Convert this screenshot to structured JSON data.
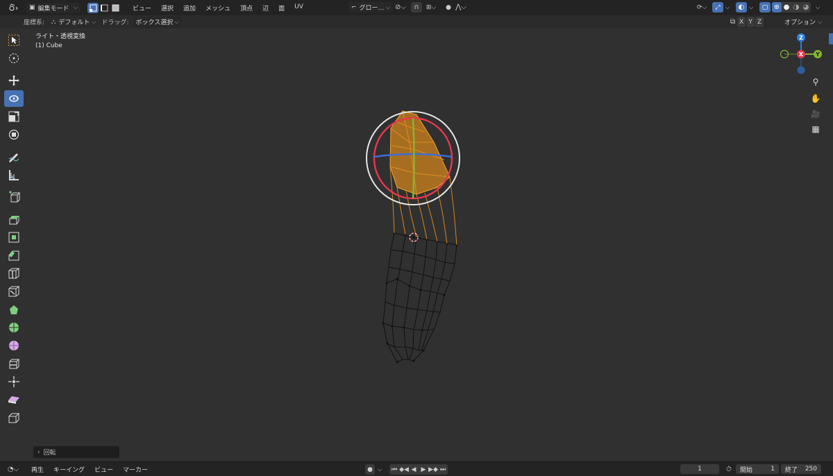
{
  "header": {
    "mode_label": "編集モード",
    "menus": [
      "ビュー",
      "選択",
      "追加",
      "メッシュ",
      "頂点",
      "辺",
      "面",
      "UV"
    ],
    "transform_orientation": "グロー...",
    "axes": [
      "X",
      "Y",
      "Z"
    ],
    "options_label": "オプション"
  },
  "subheader": {
    "coord_label": "座標系:",
    "coord_value": "デフォルト",
    "drag_label": "ドラッグ:",
    "drag_value": "ボックス選択"
  },
  "viewport": {
    "title": "ライト・透視変換",
    "object": "(1) Cube"
  },
  "gizmo": {
    "z": "Z",
    "x": "X",
    "y": "Y",
    "colors": {
      "x": "#e8374d",
      "y": "#82b831",
      "z": "#2e7ee0"
    }
  },
  "last_operation": {
    "label": "回転"
  },
  "timeline": {
    "menus": [
      "再生",
      "キーイング",
      "ビュー",
      "マーカー"
    ],
    "current_frame": "1",
    "start_label": "開始",
    "start_value": "1",
    "end_label": "終了",
    "end_value": "250"
  },
  "colors": {
    "accent": "#4772b3",
    "selection": "#e8901c"
  }
}
